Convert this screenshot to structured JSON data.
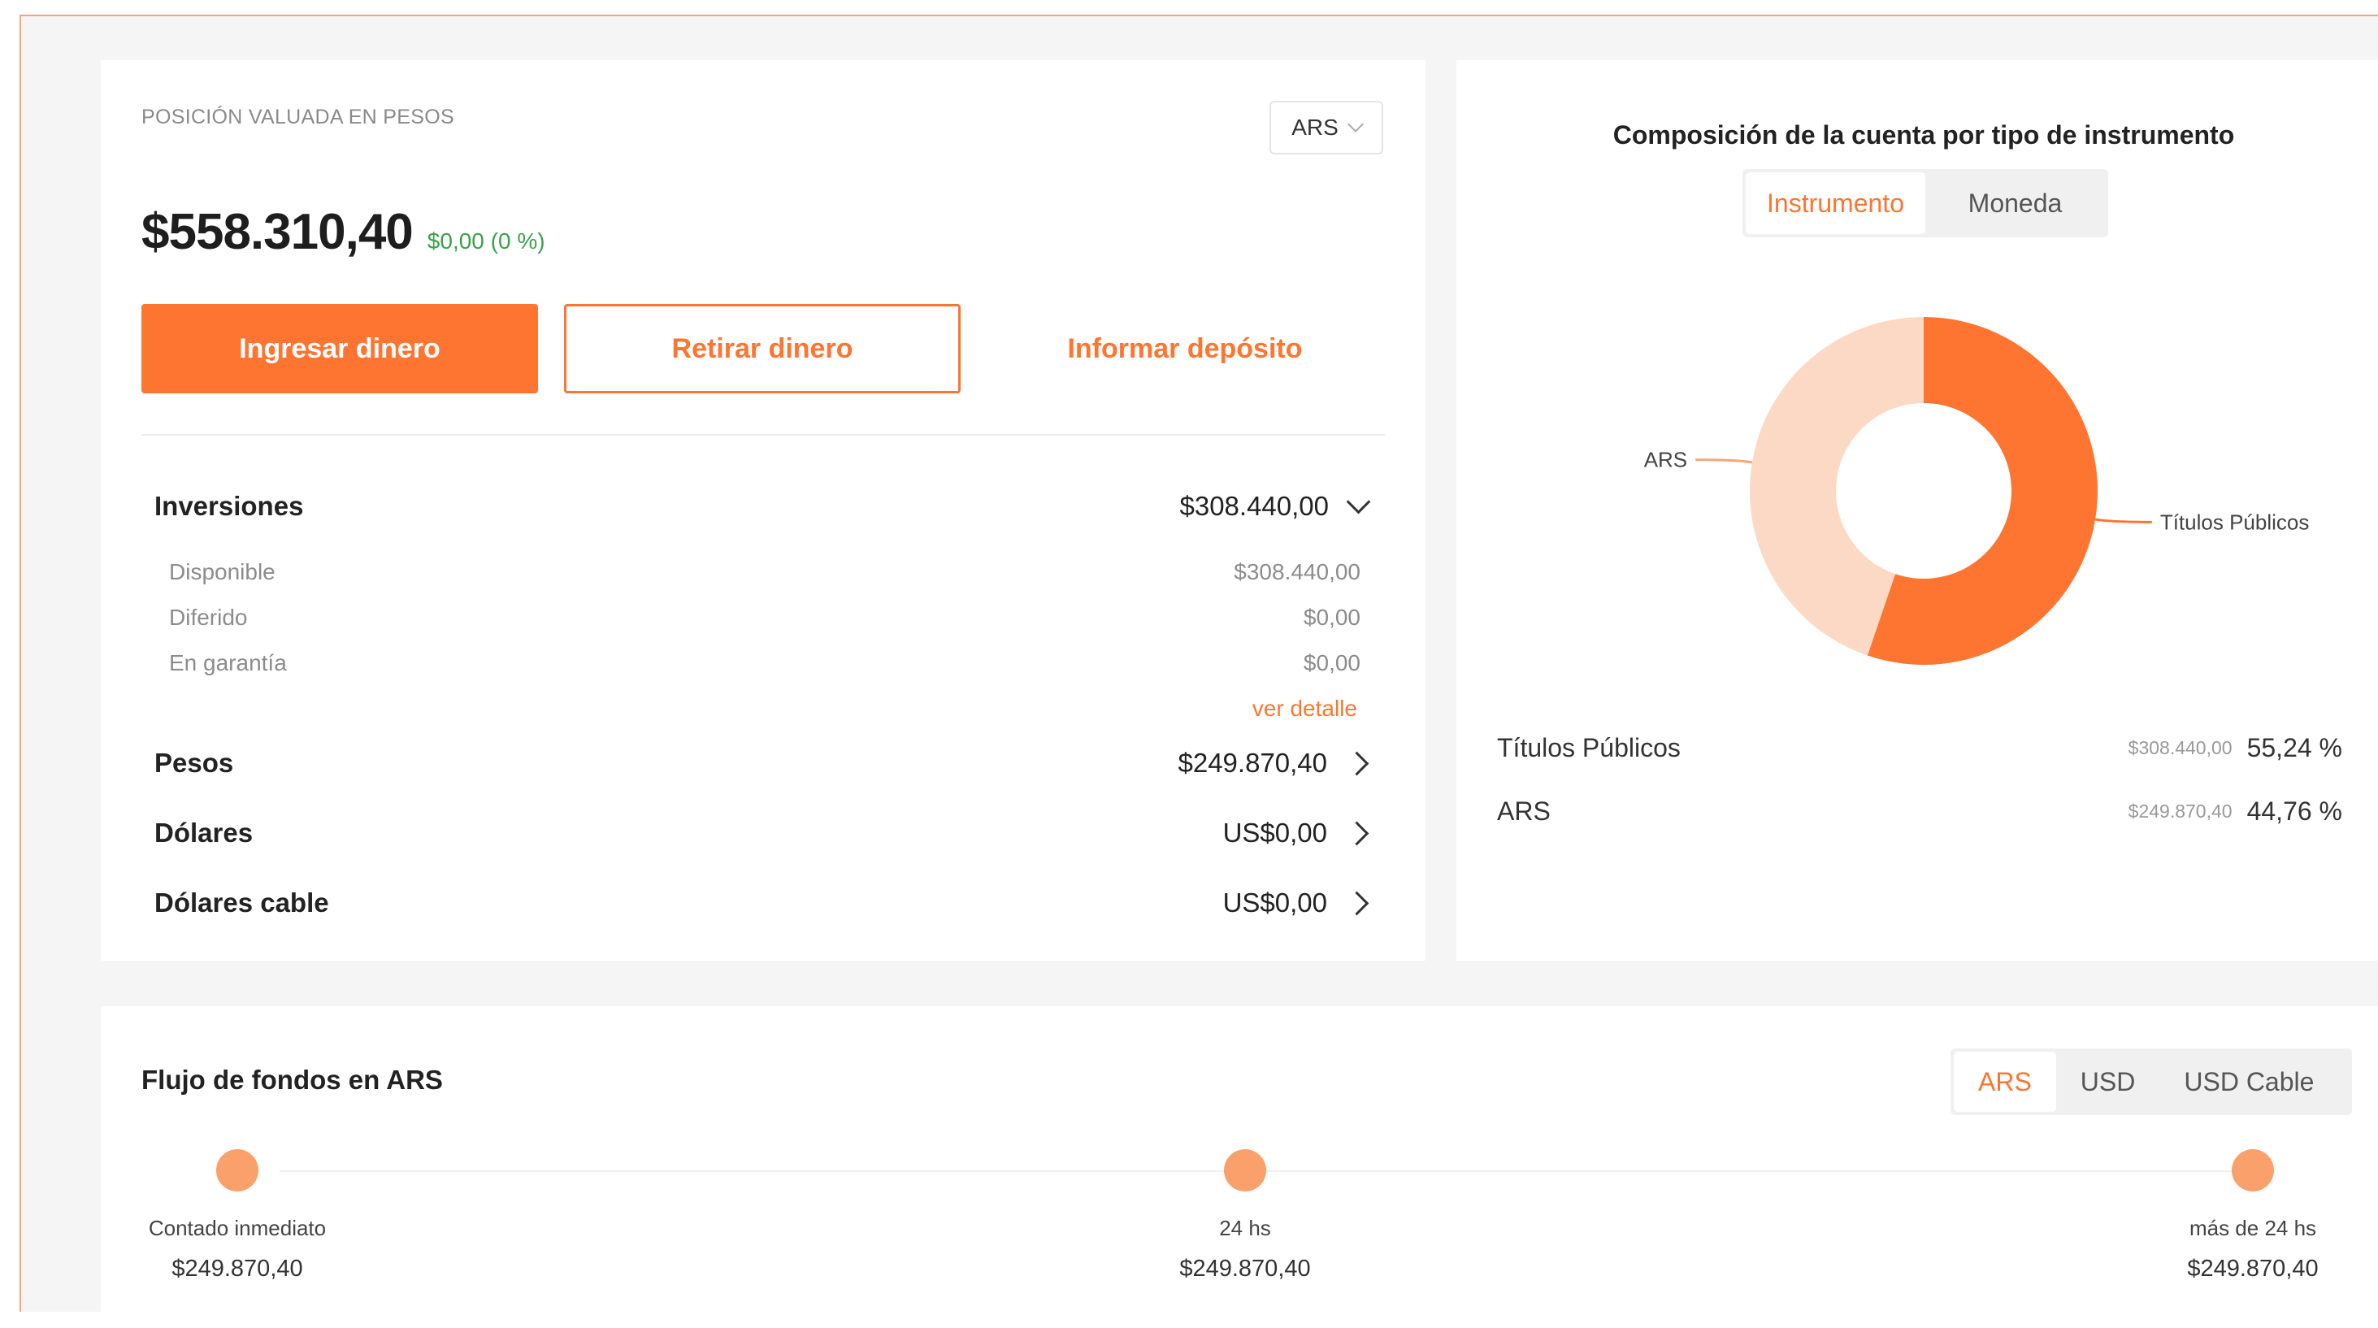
{
  "colors": {
    "accent": "#fd7530",
    "accent_light": "#fcd9c4",
    "positive": "#3aa14a"
  },
  "position": {
    "label": "POSICIÓN VALUADA EN PESOS",
    "currency_select": "ARS",
    "total": "$558.310,40",
    "change": "$0,00 (0 %)",
    "buttons": {
      "deposit": "Ingresar dinero",
      "withdraw": "Retirar dinero",
      "inform": "Informar depósito"
    },
    "inversiones": {
      "label": "Inversiones",
      "value": "$308.440,00",
      "details": [
        {
          "label": "Disponible",
          "value": "$308.440,00"
        },
        {
          "label": "Diferido",
          "value": "$0,00"
        },
        {
          "label": "En garantía",
          "value": "$0,00"
        }
      ],
      "detail_link": "ver detalle"
    },
    "accounts": [
      {
        "label": "Pesos",
        "value": "$249.870,40"
      },
      {
        "label": "Dólares",
        "value": "US$0,00"
      },
      {
        "label": "Dólares cable",
        "value": "US$0,00"
      }
    ]
  },
  "composition": {
    "title": "Composición de la cuenta por tipo de instrumento",
    "tabs": [
      "Instrumento",
      "Moneda"
    ],
    "active_tab": "Instrumento",
    "chart_data": {
      "type": "pie",
      "categories": [
        "Títulos Públicos",
        "ARS"
      ],
      "values": [
        55.24,
        44.76
      ],
      "amounts": [
        "$308.440,00",
        "$249.870,40"
      ],
      "percent_labels": [
        "55,24 %",
        "44,76 %"
      ],
      "colors": [
        "#fd7530",
        "#fcd9c4"
      ]
    }
  },
  "flow": {
    "title": "Flujo de fondos en ARS",
    "tabs": [
      "ARS",
      "USD",
      "USD Cable"
    ],
    "active_tab": "ARS",
    "points": [
      {
        "label": "Contado inmediato",
        "value": "$249.870,40"
      },
      {
        "label": "24 hs",
        "value": "$249.870,40"
      },
      {
        "label": "más de 24 hs",
        "value": "$249.870,40"
      }
    ]
  }
}
